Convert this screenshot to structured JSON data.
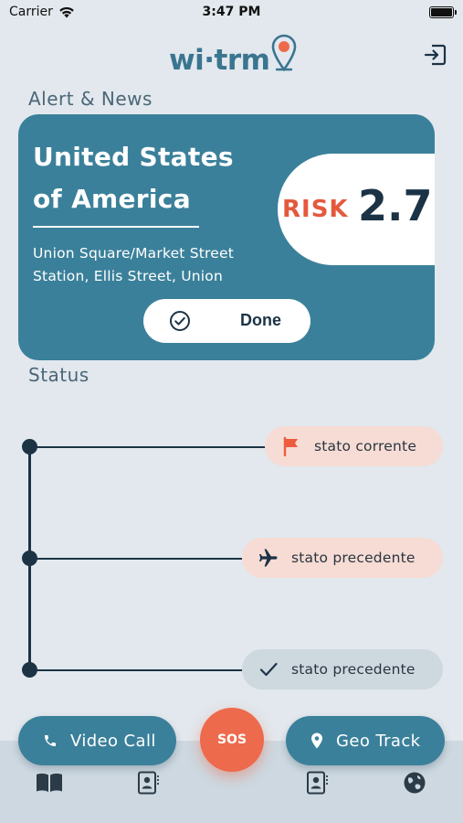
{
  "status_bar": {
    "carrier": "Carrier",
    "time": "3:47 PM"
  },
  "header": {
    "logo_text": "wi·trm",
    "logout_icon": "logout-icon"
  },
  "alert_section": {
    "title": "Alert & News",
    "card": {
      "country": "United States of America",
      "address": "Union Square/Market Street Station, Ellis Street, Union",
      "risk_label": "RISK",
      "risk_value": "2.7",
      "done_label": "Done"
    }
  },
  "status_section": {
    "title": "Status",
    "items": [
      {
        "label": "stato corrente",
        "icon": "flag-icon"
      },
      {
        "label": "stato precedente",
        "icon": "airplane-icon"
      },
      {
        "label": "stato precedente",
        "icon": "check-icon"
      }
    ]
  },
  "actions": {
    "video_call": "Video Call",
    "sos": "SOS",
    "geo_track": "Geo Track"
  },
  "tabs": [
    "book-icon",
    "contacts-icon",
    "contacts-icon",
    "globe-icon"
  ],
  "colors": {
    "primary": "#3b809a",
    "accent": "#ee6a4d",
    "dark": "#1c3346",
    "chip_active": "#f6dcd4",
    "chip_inactive": "#cdd8df",
    "background": "#e2e8ed"
  }
}
